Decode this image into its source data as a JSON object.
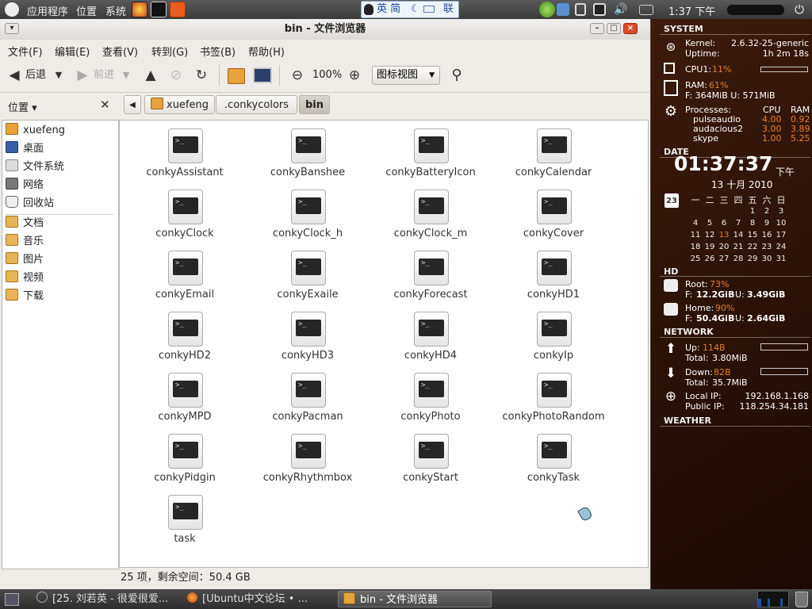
{
  "top_panel": {
    "menus": [
      "应用程序",
      "位置",
      "系统"
    ],
    "input_method": "英 简",
    "input_method_tail": "联",
    "clock": "1:37 下午"
  },
  "window": {
    "title": "bin - 文件浏览器",
    "controls": {
      "minimize": "–",
      "maximize": "□",
      "close": "×"
    },
    "menu": [
      "文件(F)",
      "编辑(E)",
      "查看(V)",
      "转到(G)",
      "书签(B)",
      "帮助(H)"
    ],
    "toolbar": {
      "back": "后退",
      "forward": "前进",
      "zoom": "100%",
      "view_mode": "图标视图"
    },
    "sidebar": {
      "header": "位置 ▾",
      "items": [
        {
          "label": "xuefeng",
          "icon": "home-folder-icon"
        },
        {
          "label": "桌面",
          "icon": "desktop-icon"
        },
        {
          "label": "文件系统",
          "icon": "filesystem-icon"
        },
        {
          "label": "网络",
          "icon": "network-icon"
        },
        {
          "label": "回收站",
          "icon": "trash-icon"
        },
        {
          "label": "文档",
          "icon": "folder-icon"
        },
        {
          "label": "音乐",
          "icon": "folder-icon"
        },
        {
          "label": "图片",
          "icon": "folder-icon"
        },
        {
          "label": "视频",
          "icon": "folder-icon"
        },
        {
          "label": "下载",
          "icon": "folder-icon"
        }
      ]
    },
    "pathbar": [
      "xuefeng",
      ".conkycolors",
      "bin"
    ],
    "files": [
      "conkyAssistant",
      "conkyBanshee",
      "conkyBatteryIcon",
      "conkyCalendar",
      "conkyClock",
      "conkyClock_h",
      "conkyClock_m",
      "conkyCover",
      "conkyEmail",
      "conkyExaile",
      "conkyForecast",
      "conkyHD1",
      "conkyHD2",
      "conkyHD3",
      "conkyHD4",
      "conkyIp",
      "conkyMPD",
      "conkyPacman",
      "conkyPhoto",
      "conkyPhotoRandom",
      "conkyPidgin",
      "conkyRhythmbox",
      "conkyStart",
      "conkyTask",
      "task"
    ],
    "file_icon_glyph": ">_",
    "status": "25 项，剩余空间：50.4 GB"
  },
  "conky": {
    "system": {
      "header": "SYSTEM",
      "kernel_label": "Kernel:",
      "kernel": "2.6.32-25-generic",
      "uptime_label": "Uptime:",
      "uptime": "1h 2m 18s",
      "cpu_label": "CPU1:",
      "cpu": "11%",
      "ram_label": "RAM:",
      "ram": "61%",
      "ram_detail": "F: 364MiB U: 571MiB",
      "processes_label": "Processes:",
      "cpu_col": "CPU",
      "ram_col": "RAM",
      "processes": [
        {
          "name": "pulseaudio",
          "cpu": "4.00",
          "ram": "0.92"
        },
        {
          "name": "audacious2",
          "cpu": "3.00",
          "ram": "3.89"
        },
        {
          "name": "skype",
          "cpu": "1.00",
          "ram": "5.25"
        }
      ]
    },
    "date": {
      "header": "DATE",
      "time": "01:37:37",
      "ampm": "下午",
      "date": "13 十月 2010",
      "cal_icon_day": "23",
      "weekdays": [
        "一",
        "二",
        "三",
        "四",
        "五",
        "六",
        "日"
      ],
      "weeks": [
        [
          "",
          "",
          "",
          "",
          "1",
          "2",
          "3"
        ],
        [
          "4",
          "5",
          "6",
          "7",
          "8",
          "9",
          "10"
        ],
        [
          "11",
          "12",
          "13",
          "14",
          "15",
          "16",
          "17"
        ],
        [
          "18",
          "19",
          "20",
          "21",
          "22",
          "23",
          "24"
        ],
        [
          "25",
          "26",
          "27",
          "28",
          "29",
          "30",
          "31"
        ]
      ],
      "today": "13"
    },
    "hd": {
      "header": "HD",
      "root_label": "Root:",
      "root_pct": "73%",
      "root_detail_f": "12.2GiB",
      "root_detail_u": "3.49GiB",
      "home_label": "Home:",
      "home_pct": "90%",
      "home_detail_f": "50.4GiB",
      "home_detail_u": "2.64GiB",
      "f_label": "F:",
      "u_label": "U:"
    },
    "network": {
      "header": "NETWORK",
      "up_label": "Up:",
      "up": "114B",
      "up_total_label": "Total:",
      "up_total": "3.80MiB",
      "down_label": "Down:",
      "down": "82B",
      "down_total_label": "Total:",
      "down_total": "35.7MiB",
      "local_ip_label": "Local IP:",
      "local_ip": "192.168.1.168",
      "public_ip_label": "Public IP:",
      "public_ip": "118.254.34.181"
    },
    "weather": {
      "header": "WEATHER"
    }
  },
  "bottom_panel": {
    "tasks": [
      "[25. 刘若英 - 很爱很爱...",
      "[Ubuntu中文论坛 • ...",
      "bin - 文件浏览器"
    ]
  },
  "colors": {
    "accent_orange": "#e87d28",
    "panel": "#3a3a3a"
  }
}
